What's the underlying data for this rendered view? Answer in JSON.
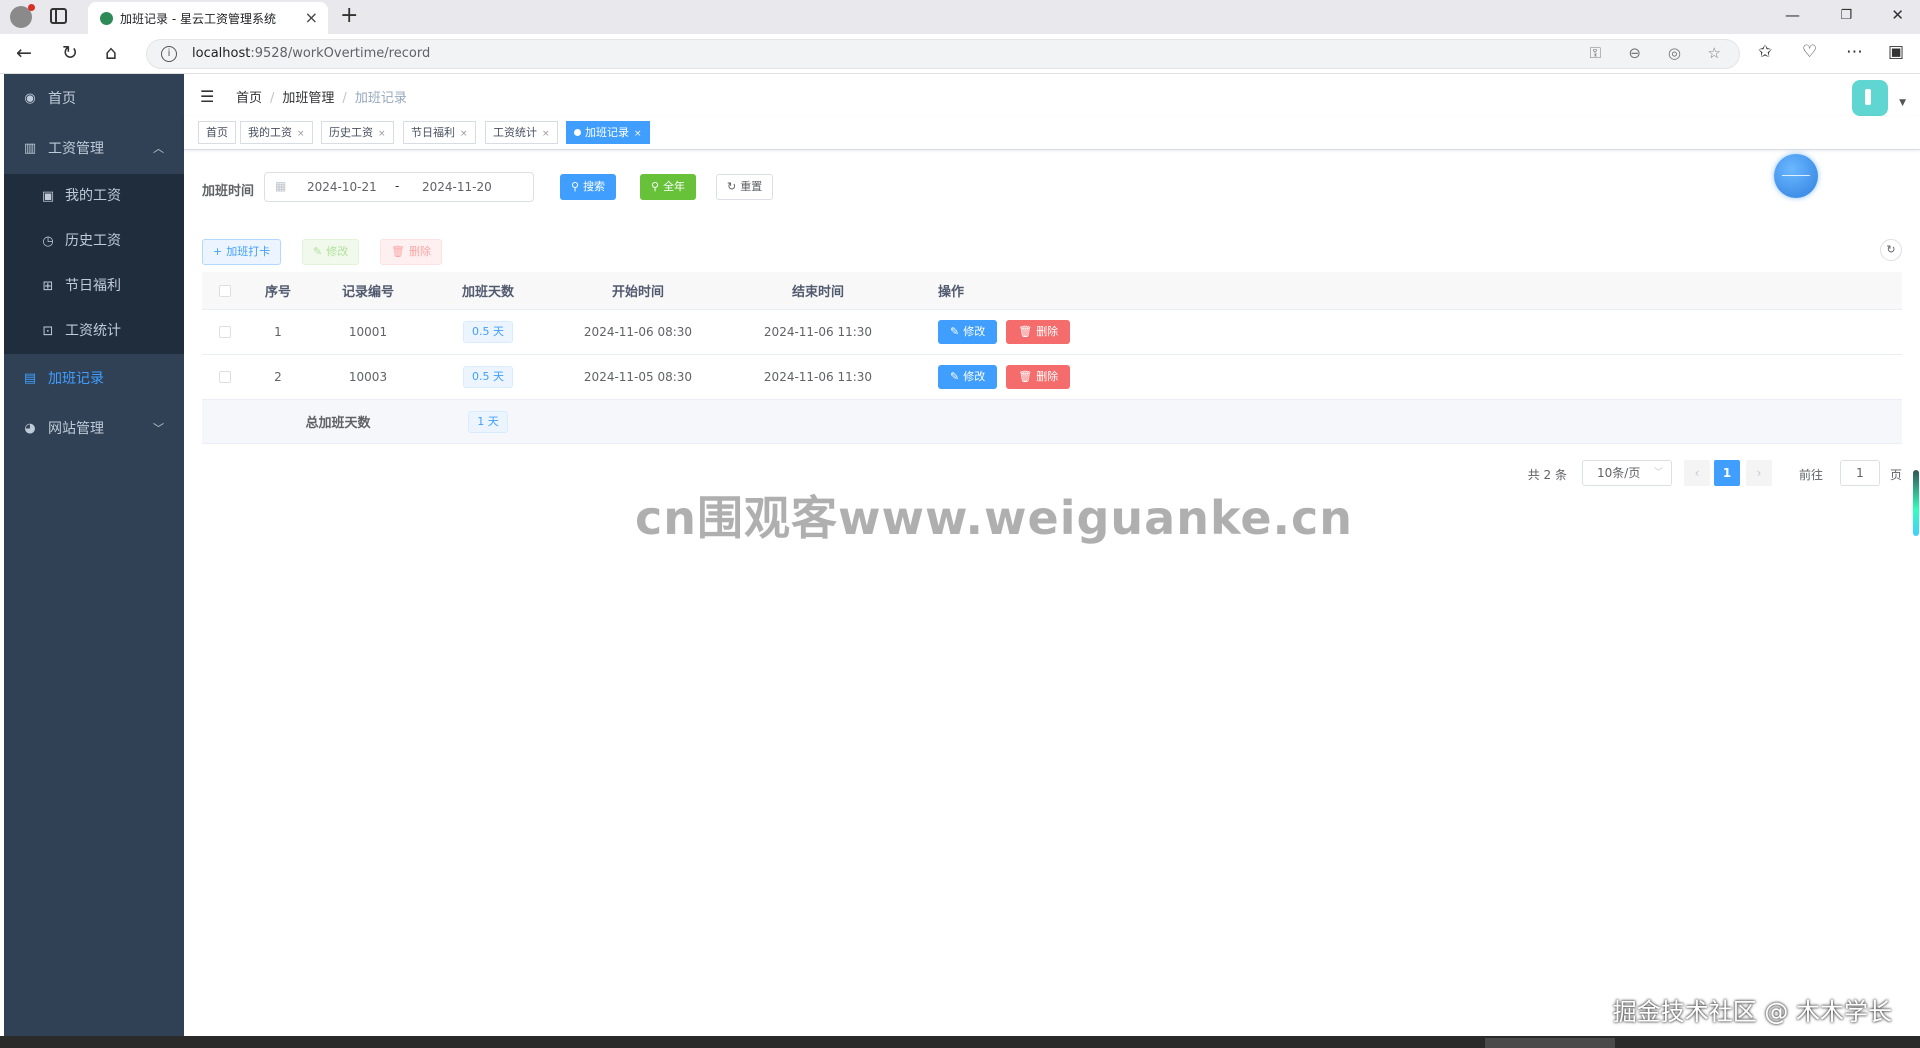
{
  "browser": {
    "tab_title": "加班记录 - 星云工资管理系统",
    "url_host": "localhost",
    "url_rest": ":9528/workOvertime/record"
  },
  "sidebar": {
    "items": [
      {
        "label": "首页",
        "icon": "dashboard-icon"
      },
      {
        "label": "工资管理",
        "icon": "salary-icon"
      },
      {
        "label": "我的工资",
        "icon": "wallet-icon"
      },
      {
        "label": "历史工资",
        "icon": "clock-icon"
      },
      {
        "label": "节日福利",
        "icon": "gift-icon"
      },
      {
        "label": "工资统计",
        "icon": "chart-icon"
      },
      {
        "label": "加班记录",
        "icon": "calendar-icon"
      },
      {
        "label": "网站管理",
        "icon": "globe-icon"
      }
    ],
    "colors": {
      "bg": "#304156",
      "sub_bg": "#1f2d3d",
      "active": "#409eff"
    }
  },
  "breadcrumb": [
    "首页",
    "加班管理",
    "加班记录"
  ],
  "tags": [
    {
      "label": "首页"
    },
    {
      "label": "我的工资"
    },
    {
      "label": "历史工资"
    },
    {
      "label": "节日福利"
    },
    {
      "label": "工资统计"
    },
    {
      "label": "加班记录"
    }
  ],
  "search": {
    "label": "加班时间",
    "date_start": "2024-10-21",
    "date_sep": "-",
    "date_end": "2024-11-20",
    "search_btn": "搜索",
    "year_btn": "全年",
    "reset_btn": "重置"
  },
  "ops": {
    "add": "加班打卡",
    "edit": "修改",
    "delete": "删除"
  },
  "table": {
    "headers": [
      "序号",
      "记录编号",
      "加班天数",
      "开始时间",
      "结束时间",
      "操作"
    ],
    "rows": [
      {
        "index": "1",
        "code": "10001",
        "days": "0.5 天",
        "start": "2024-11-06 08:30",
        "end": "2024-11-06 11:30"
      },
      {
        "index": "2",
        "code": "10003",
        "days": "0.5 天",
        "start": "2024-11-05 08:30",
        "end": "2024-11-06 11:30"
      }
    ],
    "row_edit": "修改",
    "row_delete": "删除",
    "total_label": "总加班天数",
    "total_value": "1 天"
  },
  "pagination": {
    "total": "共 2 条",
    "page_size": "10条/页",
    "current_page": "1",
    "goto_label": "前往",
    "goto_value": "1",
    "unit": "页"
  },
  "watermark": "cn围观客www.weiguanke.cn",
  "credit": "掘金技术社区 @ 木木学长"
}
